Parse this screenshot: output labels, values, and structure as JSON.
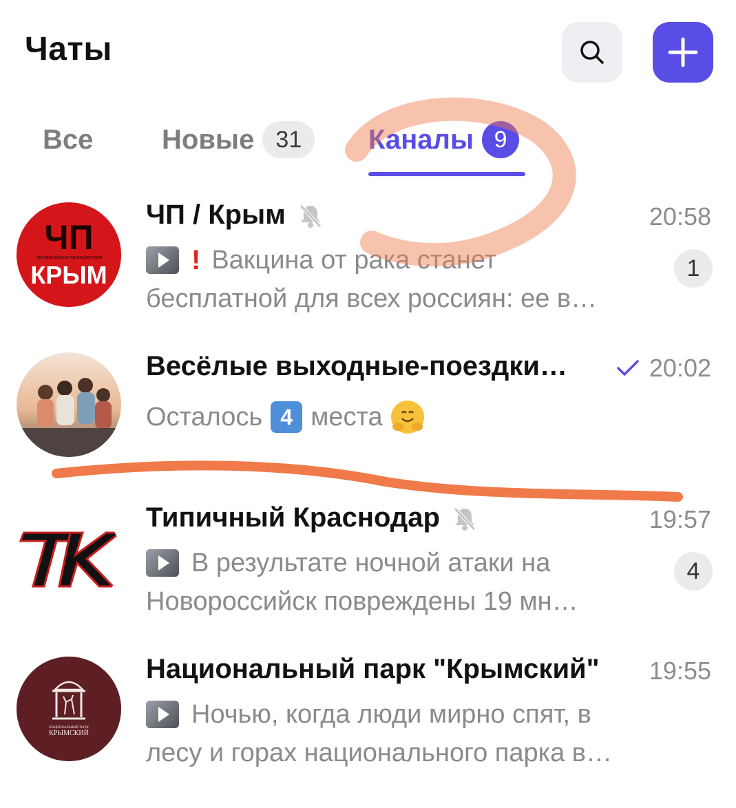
{
  "header": {
    "title": "Чаты"
  },
  "tabs": [
    {
      "label": "Все",
      "badge": ""
    },
    {
      "label": "Новые",
      "badge": "31"
    },
    {
      "label": "Каналы",
      "badge": "9"
    }
  ],
  "chats": [
    {
      "name": "ЧП / Крым",
      "time": "20:58",
      "muted": true,
      "preview_line1": "Вакцина от рака станет",
      "preview_line2": "бесплатной для всех россиян: ее в…",
      "unread": "1",
      "avatar": {
        "top_text": "ЧП",
        "middle_text": "Чрезвычайные происшествия",
        "bottom_text": "КРЫМ"
      }
    },
    {
      "name": "Весёлые выходные-поездки…",
      "time": "20:02",
      "read": true,
      "preview_before": "Осталось",
      "preview_keycap": "4",
      "preview_after": "места"
    },
    {
      "name": "Типичный Краснодар",
      "time": "19:57",
      "muted": true,
      "preview_line1": "В результате ночной атаки на",
      "preview_line2": "Новороссийск повреждены 19 мн…",
      "unread": "4"
    },
    {
      "name": "Национальный парк \"Крымский\"",
      "time": "19:55",
      "preview_line1": "Ночью, когда люди мирно спят, в",
      "preview_line2": "лесу и горах национального парка в…",
      "avatar": {
        "small_text": "НАЦИОНАЛЬНЫЙ ПАРК",
        "name_text": "КРЫМСКИЙ"
      }
    }
  ],
  "colors": {
    "accent": "#5a4de6",
    "annotation": "#f07a4a"
  },
  "icons": {
    "search": "search-icon",
    "add": "plus-icon",
    "mute": "bell-off-icon",
    "read": "check-icon"
  }
}
